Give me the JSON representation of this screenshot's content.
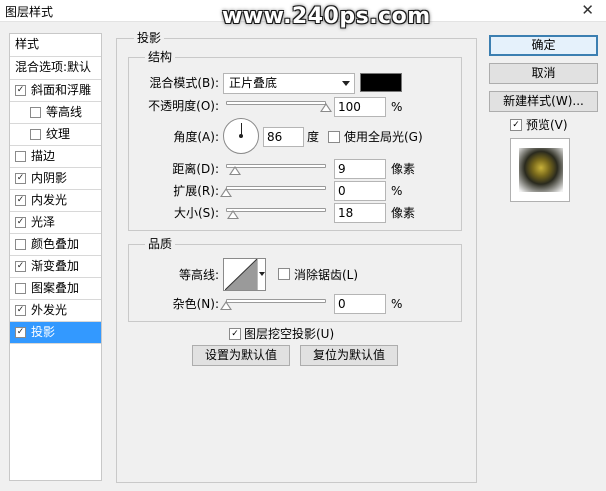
{
  "window": {
    "title": "图层样式",
    "close": "✕"
  },
  "watermark": "www.240ps.com",
  "sidebar": {
    "header": "样式",
    "blend_options": "混合选项:默认",
    "items": [
      {
        "label": "斜面和浮雕",
        "checked": true
      },
      {
        "label": "等高线",
        "checked": false
      },
      {
        "label": "纹理",
        "checked": false
      },
      {
        "label": "描边",
        "checked": false
      },
      {
        "label": "内阴影",
        "checked": true
      },
      {
        "label": "内发光",
        "checked": true
      },
      {
        "label": "光泽",
        "checked": true
      },
      {
        "label": "颜色叠加",
        "checked": false
      },
      {
        "label": "渐变叠加",
        "checked": true
      },
      {
        "label": "图案叠加",
        "checked": false
      },
      {
        "label": "外发光",
        "checked": true
      },
      {
        "label": "投影",
        "checked": true,
        "selected": true
      }
    ]
  },
  "panel": {
    "title": "投影",
    "structure": {
      "title": "结构",
      "blend_mode_label": "混合模式(B):",
      "blend_mode_value": "正片叠底",
      "color": "#000000",
      "opacity_label": "不透明度(O):",
      "opacity_value": "100",
      "opacity_unit": "%",
      "opacity_level": 1.0,
      "angle_label": "角度(A):",
      "angle_value": "86",
      "angle_unit": "度",
      "global_light_label": "使用全局光(G)",
      "global_light_checked": false,
      "distance_label": "距离(D):",
      "distance_value": "9",
      "distance_unit": "像素",
      "distance_level": 0.09,
      "spread_label": "扩展(R):",
      "spread_value": "0",
      "spread_unit": "%",
      "spread_level": 0,
      "size_label": "大小(S):",
      "size_value": "18",
      "size_unit": "像素",
      "size_level": 0.07
    },
    "quality": {
      "title": "品质",
      "contour_label": "等高线:",
      "antialias_label": "消除锯齿(L)",
      "antialias_checked": false,
      "noise_label": "杂色(N):",
      "noise_value": "0",
      "noise_unit": "%",
      "noise_level": 0
    },
    "knockout_label": "图层挖空投影(U)",
    "knockout_checked": true,
    "make_default": "设置为默认值",
    "reset_default": "复位为默认值"
  },
  "buttons": {
    "ok": "确定",
    "cancel": "取消",
    "new_style": "新建样式(W)...",
    "preview_label": "预览(V)",
    "preview_checked": true
  }
}
